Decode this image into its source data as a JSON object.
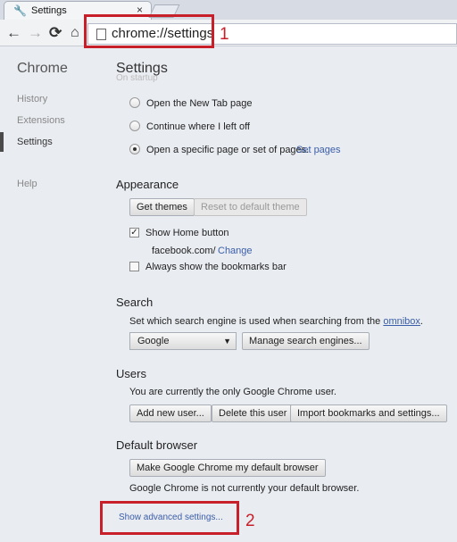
{
  "tab": {
    "title": "Settings",
    "close": "×",
    "icon": "wrench-icon"
  },
  "toolbar": {
    "back": "←",
    "forward": "→",
    "reload": "⟳",
    "home": "⌂",
    "url": "chrome://settings"
  },
  "annotations": {
    "one": "1",
    "two": "2",
    "color": "#c8202a"
  },
  "sidebar": {
    "brand": "Chrome",
    "items": [
      {
        "label": "History"
      },
      {
        "label": "Extensions"
      },
      {
        "label": "Settings"
      },
      {
        "label": "Help"
      }
    ]
  },
  "main": {
    "title": "Settings",
    "ghost": "On startup",
    "startup": {
      "options": [
        {
          "label": "Open the New Tab page",
          "checked": false
        },
        {
          "label": "Continue where I left off",
          "checked": false
        },
        {
          "label": "Open a specific page or set of pages.",
          "checked": true
        }
      ],
      "set_pages": "Set pages"
    },
    "appearance": {
      "heading": "Appearance",
      "get_themes": "Get themes",
      "reset_theme": "Reset to default theme",
      "show_home": "Show Home button",
      "home_url": "facebook.com/",
      "change": "Change",
      "bookmarks_bar": "Always show the bookmarks bar"
    },
    "search": {
      "heading": "Search",
      "description": "Set which search engine is used when searching from the",
      "omnibox": "omnibox",
      "period": ".",
      "engine": "Google",
      "manage": "Manage search engines..."
    },
    "users": {
      "heading": "Users",
      "description": "You are currently the only Google Chrome user.",
      "add": "Add new user...",
      "delete": "Delete this user",
      "import": "Import bookmarks and settings..."
    },
    "default_browser": {
      "heading": "Default browser",
      "make_default": "Make Google Chrome my default browser",
      "status": "Google Chrome is not currently your default browser."
    },
    "advanced": "Show advanced settings..."
  }
}
